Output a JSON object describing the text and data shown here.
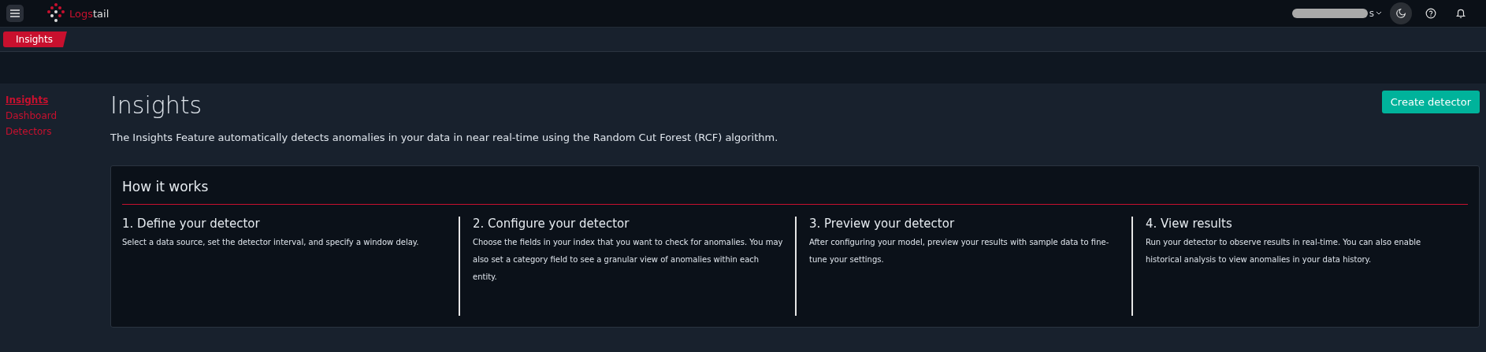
{
  "top_bar": {
    "logo": {
      "accent": "Logs",
      "rest": "tail"
    },
    "user_menu": {
      "visible_text": "s",
      "redacted": true
    }
  },
  "breadcrumbs": [
    {
      "label": "Insights",
      "selected": true
    }
  ],
  "sidebar": {
    "items": [
      {
        "label": "Insights",
        "selected": true
      },
      {
        "label": "Dashboard",
        "selected": false
      },
      {
        "label": "Detectors",
        "selected": false
      }
    ]
  },
  "page": {
    "title": "Insights",
    "description": "The Insights Feature automatically detects anomalies in your data in near real-time using the Random Cut Forest (RCF) algorithm.",
    "primary_button": "Create detector"
  },
  "how_it_works": {
    "title": "How it works",
    "steps": [
      {
        "title": "1. Define your detector",
        "text": "Select a data source, set the detector interval, and specify a window delay."
      },
      {
        "title": "2. Configure your detector",
        "text": "Choose the fields in your index that you want to check for anomalies. You may also set a category field to see a granular view of anomalies within each entity."
      },
      {
        "title": "3. Preview your detector",
        "text": "After configuring your model, preview your results with sample data to fine-tune your settings."
      },
      {
        "title": "4. View results",
        "text": "Run your detector to observe results in real-time. You can also enable historical analysis to view anomalies in your data history."
      }
    ]
  }
}
